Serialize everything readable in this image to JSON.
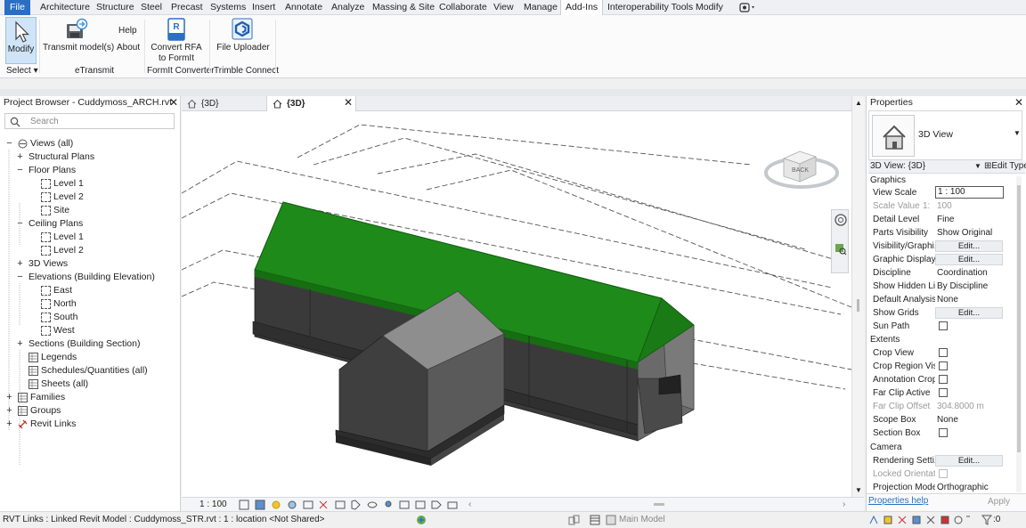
{
  "menu": {
    "tabs": [
      "File",
      "Architecture",
      "Structure",
      "Steel",
      "Precast",
      "Systems",
      "Insert",
      "Annotate",
      "Analyze",
      "Massing & Site",
      "Collaborate",
      "View",
      "Manage",
      "Add-Ins",
      "Interoperability Tools",
      "Modify"
    ],
    "active_tab": "Add-Ins"
  },
  "ribbon": {
    "modify": "Modify",
    "select": "Select",
    "transmit": "Transmit model(s)",
    "help": "Help",
    "about": "About",
    "etransmit": "eTransmit",
    "convert_line1": "Convert RFA",
    "convert_line2": "to FormIt",
    "formit_converter": "FormIt Converter",
    "file_uploader": "File Uploader",
    "trimble_connect": "Trimble Connect",
    "rfa_badge": "RFA"
  },
  "browser": {
    "title": "Project Browser - Cuddymoss_ARCH.rvt",
    "search_placeholder": "Search",
    "items": [
      {
        "label": "Views (all)",
        "toggle": "−"
      },
      {
        "label": "Structural Plans",
        "toggle": "+"
      },
      {
        "label": "Floor Plans",
        "toggle": "−"
      },
      {
        "label": "Level 1",
        "toggle": ""
      },
      {
        "label": "Level 2",
        "toggle": ""
      },
      {
        "label": "Site",
        "toggle": ""
      },
      {
        "label": "Ceiling Plans",
        "toggle": "−"
      },
      {
        "label": "Level 1",
        "toggle": ""
      },
      {
        "label": "Level 2",
        "toggle": ""
      },
      {
        "label": "3D Views",
        "toggle": "+"
      },
      {
        "label": "Elevations (Building Elevation)",
        "toggle": "−"
      },
      {
        "label": "East",
        "toggle": ""
      },
      {
        "label": "North",
        "toggle": ""
      },
      {
        "label": "South",
        "toggle": ""
      },
      {
        "label": "West",
        "toggle": ""
      },
      {
        "label": "Sections (Building Section)",
        "toggle": "+"
      },
      {
        "label": "Legends",
        "toggle": ""
      },
      {
        "label": "Schedules/Quantities (all)",
        "toggle": ""
      },
      {
        "label": "Sheets (all)",
        "toggle": ""
      },
      {
        "label": "Families",
        "toggle": "+"
      },
      {
        "label": "Groups",
        "toggle": "+"
      },
      {
        "label": "Revit Links",
        "toggle": "+"
      }
    ]
  },
  "view_tabs": [
    {
      "label": "{3D}"
    },
    {
      "label": "{3D}",
      "active": true
    }
  ],
  "view_bar": {
    "scale": "1 : 100"
  },
  "viewcube": {
    "face": "BACK"
  },
  "properties": {
    "title": "Properties",
    "type_name": "3D View",
    "selector": "3D View: {3D}",
    "edit_type": "Edit Type",
    "groups": {
      "graphics": "Graphics",
      "extents": "Extents",
      "camera": "Camera"
    },
    "rows": {
      "view_scale": {
        "key": "View Scale",
        "value": "1 : 100"
      },
      "scale_value": {
        "key": "Scale Value",
        "k2": "1:",
        "value": "100"
      },
      "detail_level": {
        "key": "Detail Level",
        "value": "Fine"
      },
      "parts_visibility": {
        "key": "Parts Visibility",
        "value": "Show Original"
      },
      "visibility_graphics": {
        "key": "Visibility/Graphi...",
        "value": "Edit..."
      },
      "graphic_display": {
        "key": "Graphic Display ...",
        "value": "Edit..."
      },
      "discipline": {
        "key": "Discipline",
        "value": "Coordination"
      },
      "show_hidden": {
        "key": "Show Hidden Li...",
        "value": "By Discipline"
      },
      "default_analysis": {
        "key": "Default Analysis...",
        "value": "None"
      },
      "show_grids": {
        "key": "Show Grids",
        "value": "Edit..."
      },
      "sun_path": {
        "key": "Sun Path"
      },
      "crop_view": {
        "key": "Crop View"
      },
      "crop_region": {
        "key": "Crop Region Vis..."
      },
      "annotation_crop": {
        "key": "Annotation Crop"
      },
      "far_clip_active": {
        "key": "Far Clip Active"
      },
      "far_clip_offset": {
        "key": "Far Clip Offset",
        "value": "304.8000 m"
      },
      "scope_box": {
        "key": "Scope Box",
        "value": "None"
      },
      "section_box": {
        "key": "Section Box"
      },
      "rendering_settings": {
        "key": "Rendering Setti...",
        "value": "Edit..."
      },
      "locked_orientation": {
        "key": "Locked Orientat..."
      },
      "projection_mode": {
        "key": "Projection Mode",
        "value": "Orthographic"
      }
    },
    "help_link": "Properties help",
    "apply": "Apply"
  },
  "status": {
    "text": "RVT Links : Linked Revit Model : Cuddymoss_STR.rvt : 1 : location <Not Shared>",
    "main_model": "Main Model",
    "filter_count": ":0"
  },
  "colors": {
    "accent": "#2a6fc4",
    "roof_green": "#1e8a1a",
    "wall_dark": "#3a3a3a",
    "roof_grey": "#8e8e8e"
  }
}
